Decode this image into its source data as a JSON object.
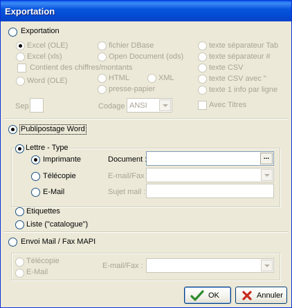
{
  "window": {
    "title": "Exportation"
  },
  "export_section": {
    "radio_label": "Exportation",
    "col1": [
      "Excel (OLE)",
      "Excel (xls)",
      "Contient des chiffres/montants",
      "Word (OLE)"
    ],
    "col2": [
      "fichier DBase",
      "Open Document (ods)",
      "HTML",
      "XML",
      "presse-papier"
    ],
    "col3": [
      "texte séparateur Tab",
      "texte séparateur #",
      "texte CSV",
      "texte CSV avec \"",
      "texte 1 info par ligne",
      "Avec Titres"
    ],
    "sep_label": "Sep",
    "sep_value": "",
    "codage_label": "Codage",
    "codage_value": "ANSI"
  },
  "publipostage": {
    "radio_label": "Publipostage Word",
    "lettre_type": "Lettre - Type",
    "imprimante": "Imprimante",
    "telecopie": "Télécopie",
    "email": "E-Mail",
    "document_label": "Document :",
    "document_value": "",
    "emailfax_label": "E-mail/Fax :",
    "emailfax_value": "",
    "sujet_label": "Sujet mail :",
    "sujet_value": "",
    "etiquettes": "Etiquettes",
    "liste": "Liste (\"catalogue\")",
    "dots_label": "..."
  },
  "envoi": {
    "radio_label": "Envoi Mail / Fax  MAPI",
    "telecopie": "Télécopie",
    "email": "E-Mail",
    "emailfax_label": "E-mail/Fax :",
    "emailfax_value": ""
  },
  "buttons": {
    "ok": "OK",
    "cancel": "Annuler"
  },
  "colors": {
    "title_bar": "#0A5FEA",
    "dialog_bg": "#ECE9D8",
    "radio_dot": "#21A121",
    "disabled_text": "#A7A493",
    "ok_check": "#2E8B2E",
    "cancel_x": "#C8281E"
  },
  "icons": [
    "check-icon",
    "x-icon",
    "ellipsis-icon",
    "chevron-down-icon"
  ]
}
